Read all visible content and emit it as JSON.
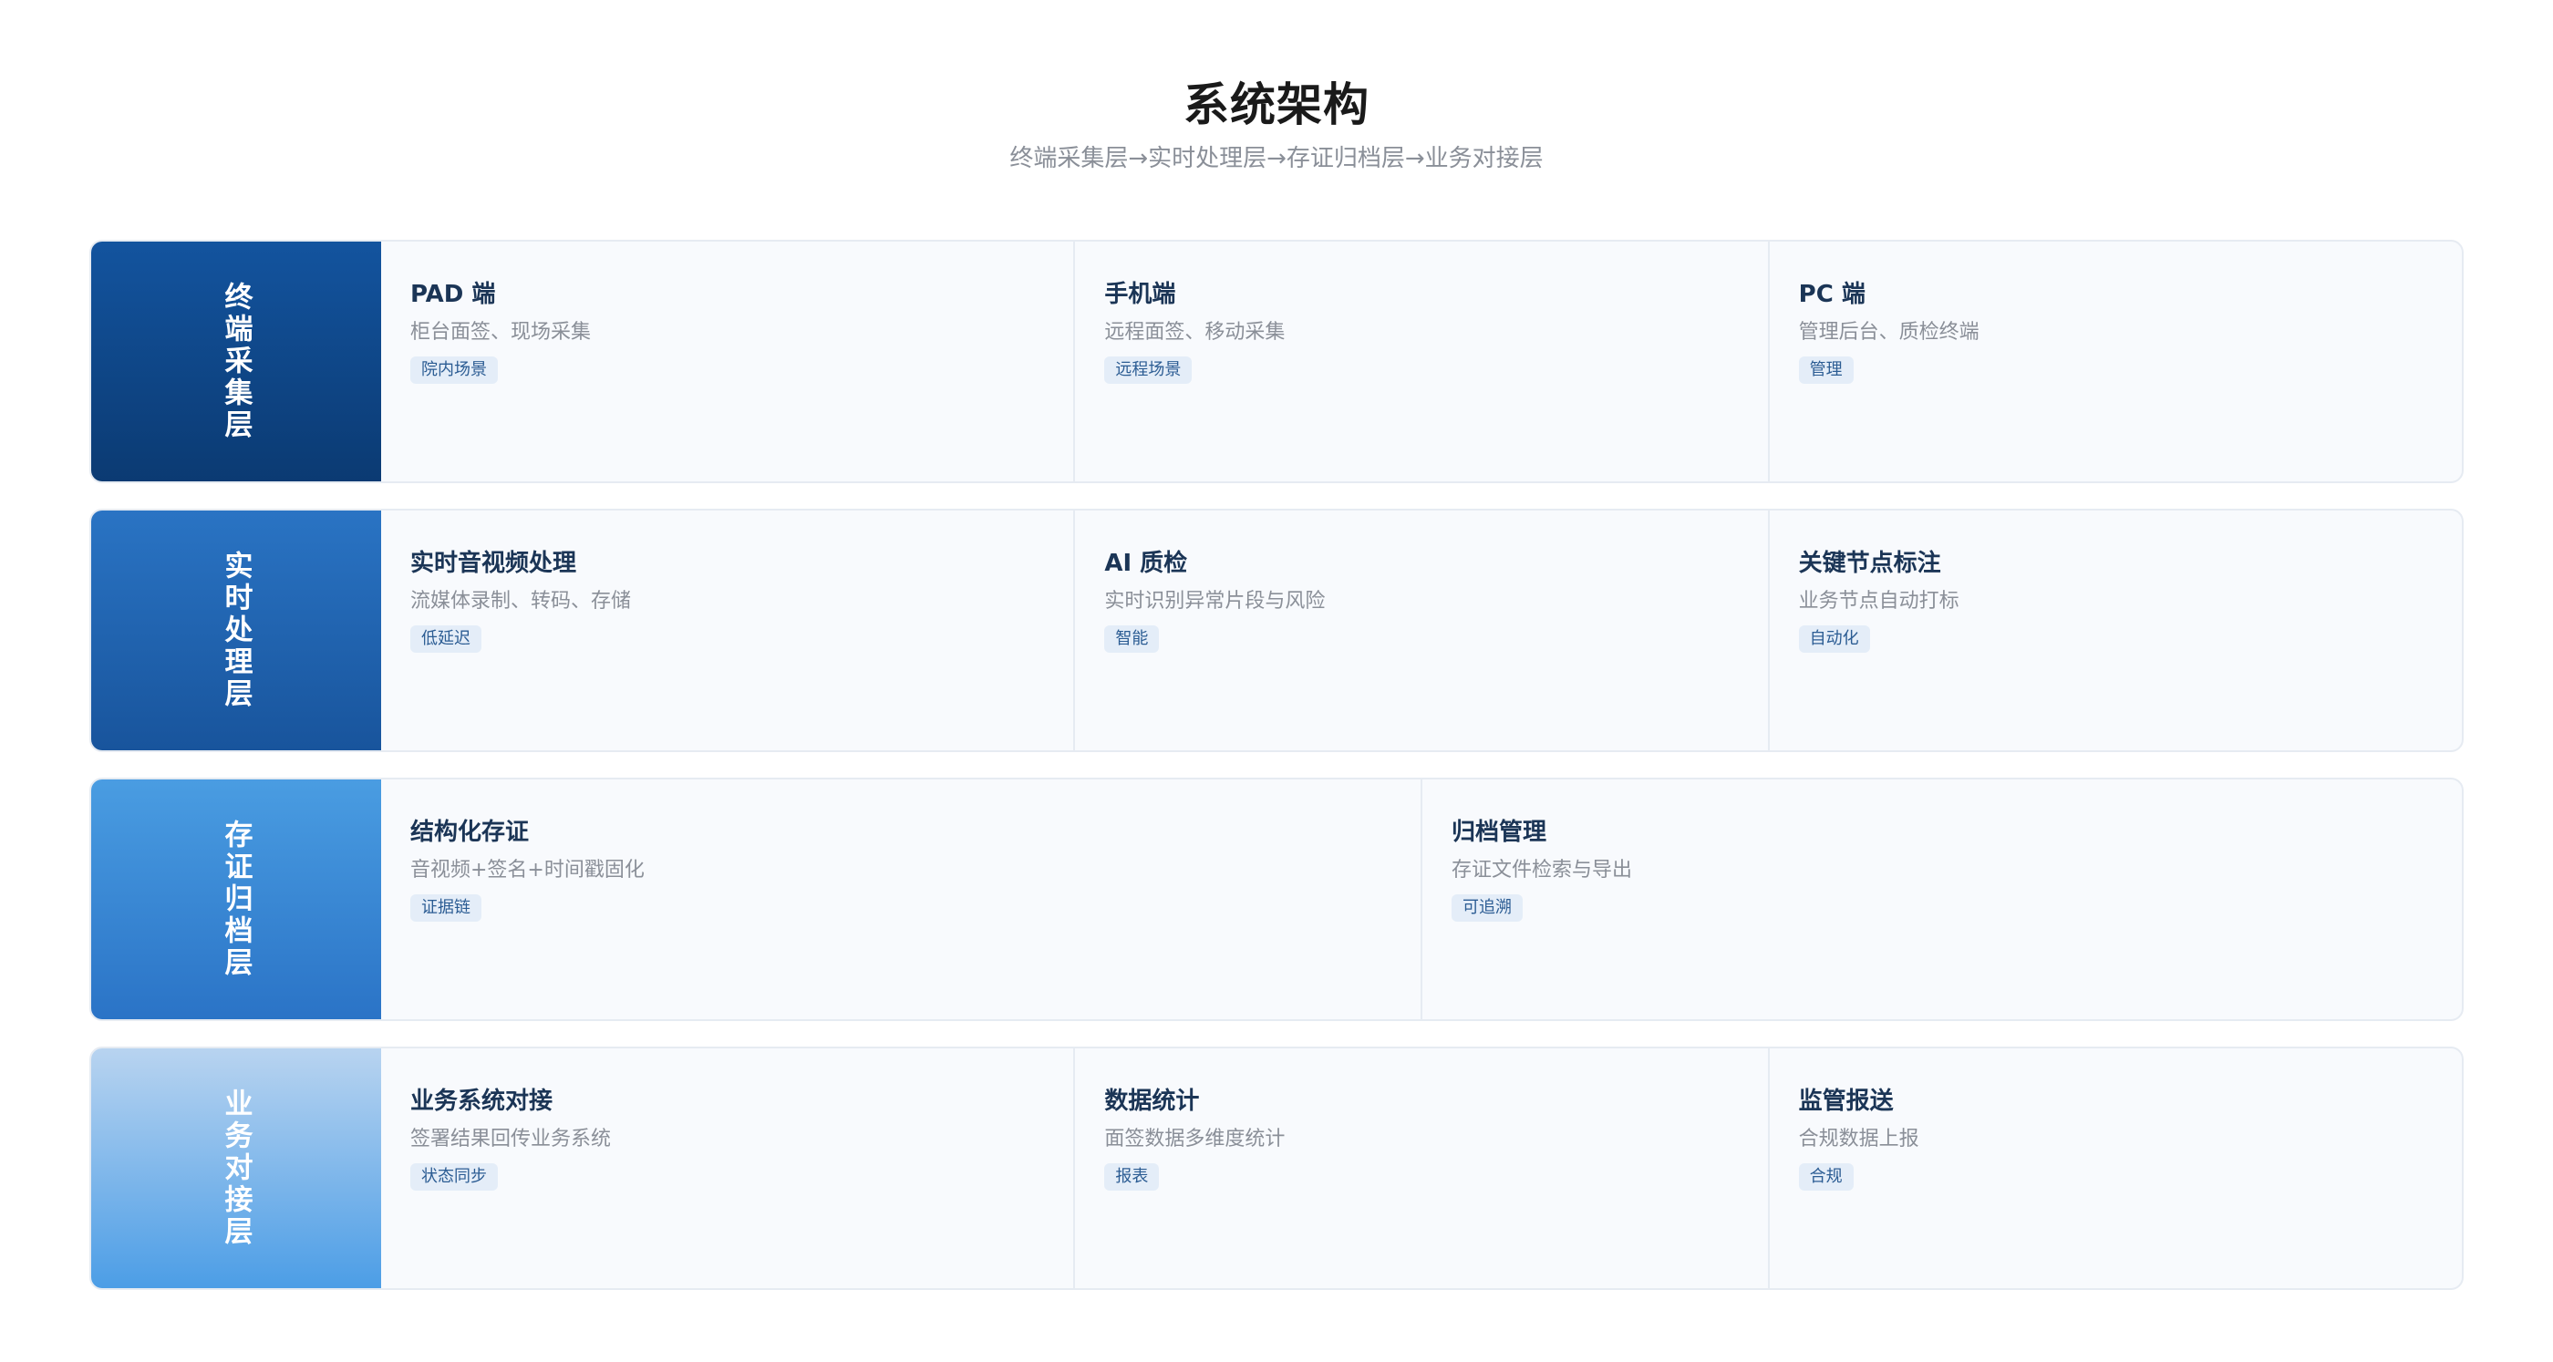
{
  "title": "系统架构",
  "subtitle": "终端采集层→实时处理层→存证归档层→业务对接层",
  "layers": [
    {
      "label": "终端采集层",
      "color_top": "#13549f",
      "color_bottom": "#0b3a72",
      "cells": [
        {
          "title": "PAD 端",
          "desc": "柜台面签、现场采集",
          "tag": "院内场景"
        },
        {
          "title": "手机端",
          "desc": "远程面签、移动采集",
          "tag": "远程场景"
        },
        {
          "title": "PC 端",
          "desc": "管理后台、质检终端",
          "tag": "管理"
        }
      ]
    },
    {
      "label": "实时处理层",
      "color_top": "#2a74c4",
      "color_bottom": "#18549c",
      "cells": [
        {
          "title": "实时音视频处理",
          "desc": "流媒体录制、转码、存储",
          "tag": "低延迟"
        },
        {
          "title": "AI 质检",
          "desc": "实时识别异常片段与风险",
          "tag": "智能"
        },
        {
          "title": "关键节点标注",
          "desc": "业务节点自动打标",
          "tag": "自动化"
        }
      ]
    },
    {
      "label": "存证归档层",
      "color_top": "#4a9de2",
      "color_bottom": "#2a73c6",
      "cells": [
        {
          "title": "结构化存证",
          "desc": "音视频+签名+时间戳固化",
          "tag": "证据链"
        },
        {
          "title": "归档管理",
          "desc": "存证文件检索与导出",
          "tag": "可追溯"
        }
      ]
    },
    {
      "label": "业务对接层",
      "color_top": "#b9d4f0",
      "color_bottom": "#4b9de6",
      "cells": [
        {
          "title": "业务系统对接",
          "desc": "签署结果回传业务系统",
          "tag": "状态同步"
        },
        {
          "title": "数据统计",
          "desc": "面签数据多维度统计",
          "tag": "报表"
        },
        {
          "title": "监管报送",
          "desc": "合规数据上报",
          "tag": "合规"
        }
      ]
    }
  ]
}
